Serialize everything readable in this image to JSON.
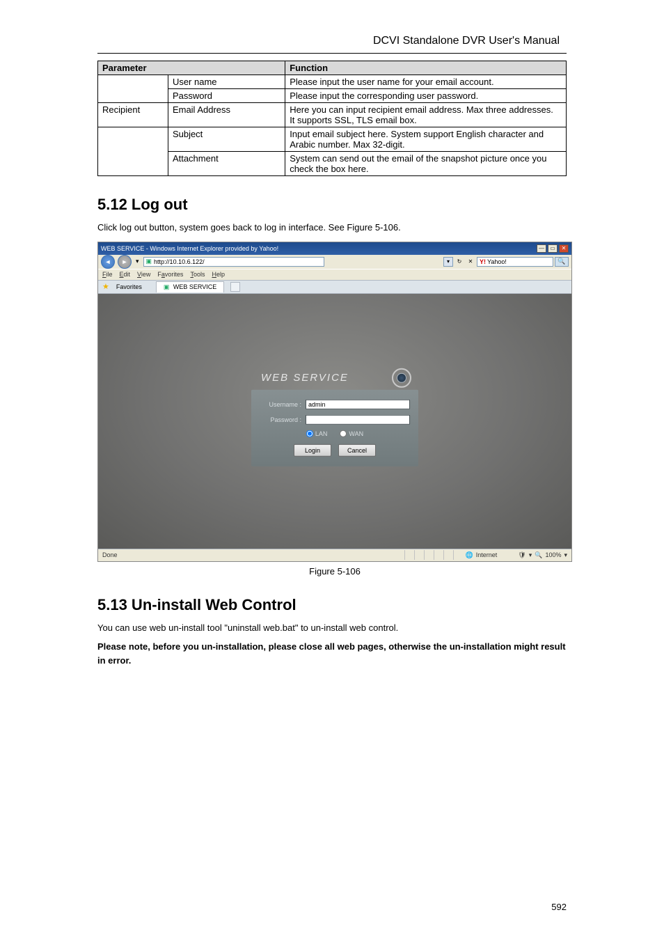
{
  "header": {
    "title": "DCVI Standalone DVR User's Manual"
  },
  "table": {
    "header": {
      "parameter": "Parameter",
      "function": "Function"
    },
    "rows": [
      {
        "group": "",
        "items": [
          {
            "param": "User name",
            "func": "Please input the user name for your email account."
          },
          {
            "param": "Password",
            "func": "Please input the corresponding user password."
          }
        ],
        "rowspan": 2
      },
      {
        "group": "Recipient",
        "items": [
          {
            "param": "Email Address",
            "func": "Here you can input recipient email address. Max three addresses.\nIt supports SSL, TLS email box."
          }
        ],
        "rowspan": 1
      },
      {
        "group": "",
        "items": [
          {
            "param": "Subject",
            "func": "Input email subject here. System support English character and Arabic number. Max 32-digit."
          },
          {
            "param": "Attachment",
            "func": "System can send out the email of the snapshot picture once you check the box here."
          }
        ],
        "rowspan": 2
      }
    ]
  },
  "section_logout": {
    "heading": "5.12  Log out",
    "body": "Click log out button, system goes back to log in interface. See Figure 5-106."
  },
  "figure": {
    "caption": "Figure 5-106"
  },
  "section_uninstall": {
    "heading": "5.13  Un-install Web Control",
    "body1_pre": "You can use web un-install tool ",
    "body1_quote": "\"uninstall web.bat\"",
    "body1_post": " to un-install web control.",
    "body2": "Please note, before you un-installation, please close all web pages, otherwise the un-installation might result in error."
  },
  "browser": {
    "title": "WEB SERVICE - Windows Internet Explorer provided by Yahoo!",
    "url": "http://10.10.6.122/",
    "menu": {
      "file": "File",
      "edit": "Edit",
      "view": "View",
      "favorites": "Favorites",
      "tools": "Tools",
      "help": "Help"
    },
    "fav_label": "Favorites",
    "tab_label": "WEB SERVICE",
    "search_provider": "Yahoo!",
    "login": {
      "brand": "WEB  SERVICE",
      "username_label": "Username :",
      "username_value": "admin",
      "password_label": "Password :",
      "password_value": "",
      "radio_lan": "LAN",
      "radio_wan": "WAN",
      "login_btn": "Login",
      "cancel_btn": "Cancel"
    },
    "status": {
      "done": "Done",
      "zone": "Internet",
      "zoom": "100%"
    }
  },
  "page_number": "592"
}
